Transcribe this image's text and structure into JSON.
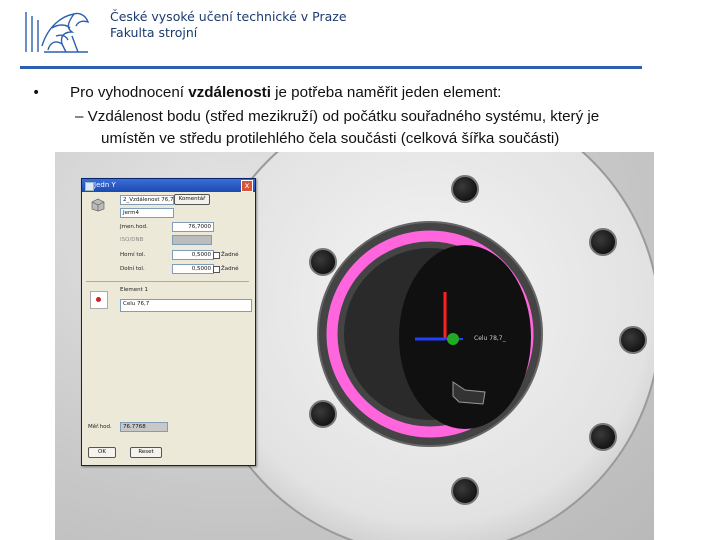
{
  "header": {
    "university": "České vysoké učení technické v Praze",
    "faculty": "Fakulta strojní"
  },
  "slide": {
    "bullet_main_prefix": "Pro vyhodnocení ",
    "bullet_main_bold": "vzdálenosti",
    "bullet_main_suffix": " je potřeba naměřit jeden element:",
    "sub_line1": "– Vzdálenost bodu (střed mezikruží) od počátku souřadného systému, který je",
    "sub_line2": "umístěn ve středu protilehlého čela součásti (celková šířka součásti)"
  },
  "dialog": {
    "title": "Jedn Y",
    "close": "x",
    "name_value": "2_Vzdálenost 76,7",
    "comment_button": "Komentář",
    "unit_select": "Jerm4",
    "nominal_label": "Jmen.hod.",
    "nominal_value": "76,7000",
    "isocode_label": "ISO/DNB",
    "upper_tol_label": "Horní tol.",
    "upper_tol_value": "0,5000",
    "lower_tol_label": "Dolní tol.",
    "lower_tol_value": "0,5000",
    "none_label_1": "Žadné",
    "none_label_2": "Žadné",
    "element_label": "Element 1",
    "element_value": "Celu 76,7",
    "measured_label": "Měř.hod.",
    "measured_value": "76.7768",
    "ok_button": "OK",
    "reset_button": "Reset"
  },
  "scene": {
    "point_label": "Celu 78,7_",
    "ring_color": "#ff66dd",
    "logo_color": "#2b5fb0"
  }
}
